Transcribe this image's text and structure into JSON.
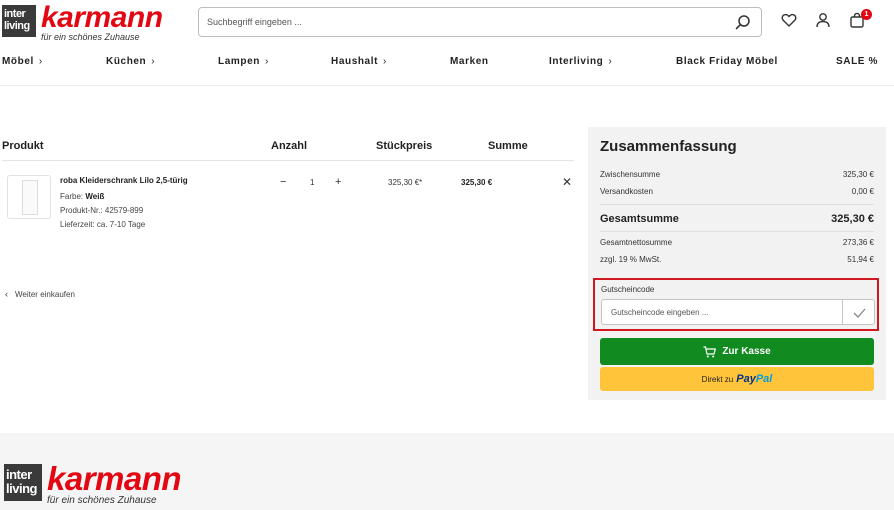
{
  "header": {
    "logo": {
      "box_line1": "inter",
      "box_line2": "living",
      "brand": "karmann",
      "tagline": "für ein schönes Zuhause"
    },
    "search": {
      "placeholder": "Suchbegriff eingeben ..."
    },
    "cart_count": "1",
    "icons": [
      "search-icon",
      "heart-icon",
      "user-icon",
      "shopping-bag-icon"
    ]
  },
  "nav": {
    "items": [
      {
        "label": "Möbel",
        "chevron": "›"
      },
      {
        "label": "Küchen",
        "chevron": "›"
      },
      {
        "label": "Lampen",
        "chevron": "›"
      },
      {
        "label": "Haushalt",
        "chevron": "›"
      },
      {
        "label": "Marken",
        "chevron": ""
      },
      {
        "label": "Interliving",
        "chevron": "›"
      },
      {
        "label": "Black Friday Möbel",
        "chevron": ""
      },
      {
        "label": "SALE %",
        "chevron": ""
      }
    ]
  },
  "cart": {
    "columns": {
      "product": "Produkt",
      "quantity": "Anzahl",
      "unit_price": "Stückpreis",
      "sum": "Summe"
    },
    "items": [
      {
        "name": "roba Kleiderschrank Lilo 2,5-türig",
        "color_label": "Farbe:",
        "color_value": "Weiß",
        "product_no": "Produkt-Nr.: 42579-899",
        "delivery": "Lieferzeit: ca. 7-10 Tage",
        "qty_minus": "−",
        "quantity": "1",
        "qty_plus": "+",
        "unit_price": "325,30 €*",
        "sum": "325,30 €",
        "remove": "✕"
      }
    ],
    "continue_shopping": "Weiter einkaufen",
    "continue_arrow": "‹"
  },
  "summary": {
    "title": "Zusammenfassung",
    "subtotal_label": "Zwischensumme",
    "subtotal_value": "325,30 €",
    "shipping_label": "Versandkosten",
    "shipping_value": "0,00 €",
    "total_label": "Gesamtsumme",
    "total_value": "325,30 €",
    "net_label": "Gesamtnettosumme",
    "net_value": "273,36 €",
    "vat_label": "zzgl. 19 % MwSt.",
    "vat_value": "51,94 €",
    "coupon_label": "Gutscheincode",
    "coupon_placeholder": "Gutscheincode eingeben ...",
    "checkout_label": "Zur Kasse",
    "paypal_prefix": "Direkt zu",
    "paypal_pay": "Pay",
    "paypal_pal": "Pal"
  },
  "footer": {
    "logo": {
      "box_line1": "inter",
      "box_line2": "living",
      "brand": "karmann",
      "tagline": "für ein schönes Zuhause"
    }
  },
  "colors": {
    "brand_red": "#e30613",
    "checkout_green": "#118a1f",
    "paypal_yellow": "#ffc439",
    "highlight_red": "#d0191f"
  }
}
